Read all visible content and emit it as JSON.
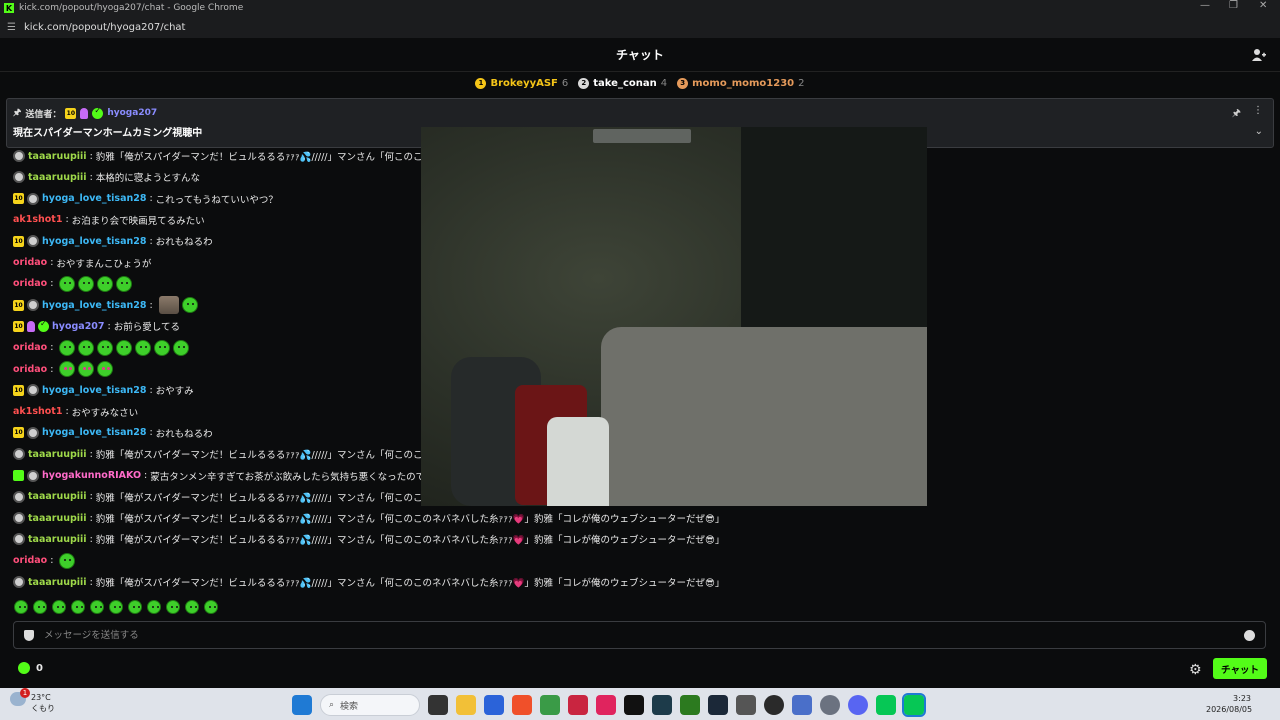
{
  "window": {
    "title": "kick.com/popout/hyoga207/chat - Google Chrome",
    "url": "kick.com/popout/hyoga207/chat"
  },
  "header": {
    "title": "チャット"
  },
  "leaderboard": [
    {
      "rank": "1",
      "name": "BrokeyyASF",
      "count": "6",
      "color": "#f5c518",
      "name_color": "#f5c518"
    },
    {
      "rank": "2",
      "name": "take_conan",
      "count": "4",
      "color": "#d9d9d9",
      "name_color": "#ffffff"
    },
    {
      "rank": "3",
      "name": "momo_momo1230",
      "count": "2",
      "color": "#e59a5b",
      "name_color": "#e59a5b"
    }
  ],
  "pinned": {
    "label": "送信者：",
    "sub_months": "10",
    "user": "hyoga207",
    "user_color": "#8a8cff",
    "text": "現在スパイダーマンホームカミング視聴中"
  },
  "messages": [
    {
      "user": "taaaruupiii",
      "color": "#9fd94a",
      "text": "豹雅「俺がスパイダーマンだ！ビュルるるるｧｧｧ💦/////」マンさん「何このこのネ"
    },
    {
      "user": "taaaruupiii",
      "color": "#9fd94a",
      "text": "本格的に寝ようとすんな"
    },
    {
      "user": "hyoga_love_tisan28",
      "color": "#3db8f5",
      "text": "これってもうねていいやつ？"
    },
    {
      "user": "ak1shot1",
      "color": "#ff5050",
      "text": "お泊まり会で映画見てるみたい"
    },
    {
      "user": "hyoga_love_tisan28",
      "color": "#3db8f5",
      "text": "おれもねるわ"
    },
    {
      "user": "oridao",
      "color": "#ff4f7b",
      "text": "おやすまんこひょうが"
    },
    {
      "user": "oridao",
      "color": "#ff4f7b",
      "text": ""
    },
    {
      "user": "hyoga_love_tisan28",
      "color": "#3db8f5",
      "text": ""
    },
    {
      "user": "hyoga207",
      "color": "#8a8cff",
      "text": "お前ら愛してる"
    },
    {
      "user": "oridao",
      "color": "#ff4f7b",
      "text": ""
    },
    {
      "user": "oridao",
      "color": "#ff4f7b",
      "text": ""
    },
    {
      "user": "hyoga_love_tisan28",
      "color": "#3db8f5",
      "text": "おやすみ"
    },
    {
      "user": "ak1shot1",
      "color": "#ff5050",
      "text": "おやすみなさい"
    },
    {
      "user": "hyoga_love_tisan28",
      "color": "#3db8f5",
      "text": "おれもねるわ"
    },
    {
      "user": "taaaruupiii",
      "color": "#9fd94a",
      "text": "豹雅「俺がスパイダーマンだ！ビュルるるるｧｧｧ💦/////」マンさん「何このこのネ"
    },
    {
      "user": "hyogakunnoRIAKO",
      "color": "#ff6bc9",
      "text": "蒙古タンメン辛すぎてお茶がぶ飲みしたら気持ち悪くなったので豹雅"
    },
    {
      "user": "taaaruupiii",
      "color": "#9fd94a",
      "text": "豹雅「俺がスパイダーマンだ！ビュルるるるｧｧｧ💦/////」マンさん「何このこのネ"
    },
    {
      "user": "taaaruupiii",
      "color": "#9fd94a",
      "text": "豹雅「俺がスパイダーマンだ！ビュルるるるｧｧｧ💦/////」マンさん「何このこのネバネバした糸ｧｧｧ💗」豹雅「コレが俺のウェブシューターだぜ😎」"
    },
    {
      "user": "taaaruupiii",
      "color": "#9fd94a",
      "text": "豹雅「俺がスパイダーマンだ！ビュルるるるｧｧｧ💦/////」マンさん「何このこのネバネバした糸ｧｧｧ💗」豹雅「コレが俺のウェブシューターだぜ😎」"
    },
    {
      "user": "oridao",
      "color": "#ff4f7b",
      "text": ""
    },
    {
      "user": "taaaruupiii",
      "color": "#9fd94a",
      "text": "豹雅「俺がスパイダーマンだ！ビュルるるるｧｧｧ💦/////」マンさん「何このこのネバネバした糸ｧｧｧ💗」豹雅「コレが俺のウェブシューターだぜ😎」"
    }
  ],
  "input": {
    "placeholder": "メッセージを送信する"
  },
  "footer": {
    "points": "0",
    "send_label": "チャット"
  },
  "taskbar": {
    "temp": "23°C",
    "weather": "くもり",
    "search": "検索",
    "time": "3:23",
    "date": "2026/08/05"
  }
}
